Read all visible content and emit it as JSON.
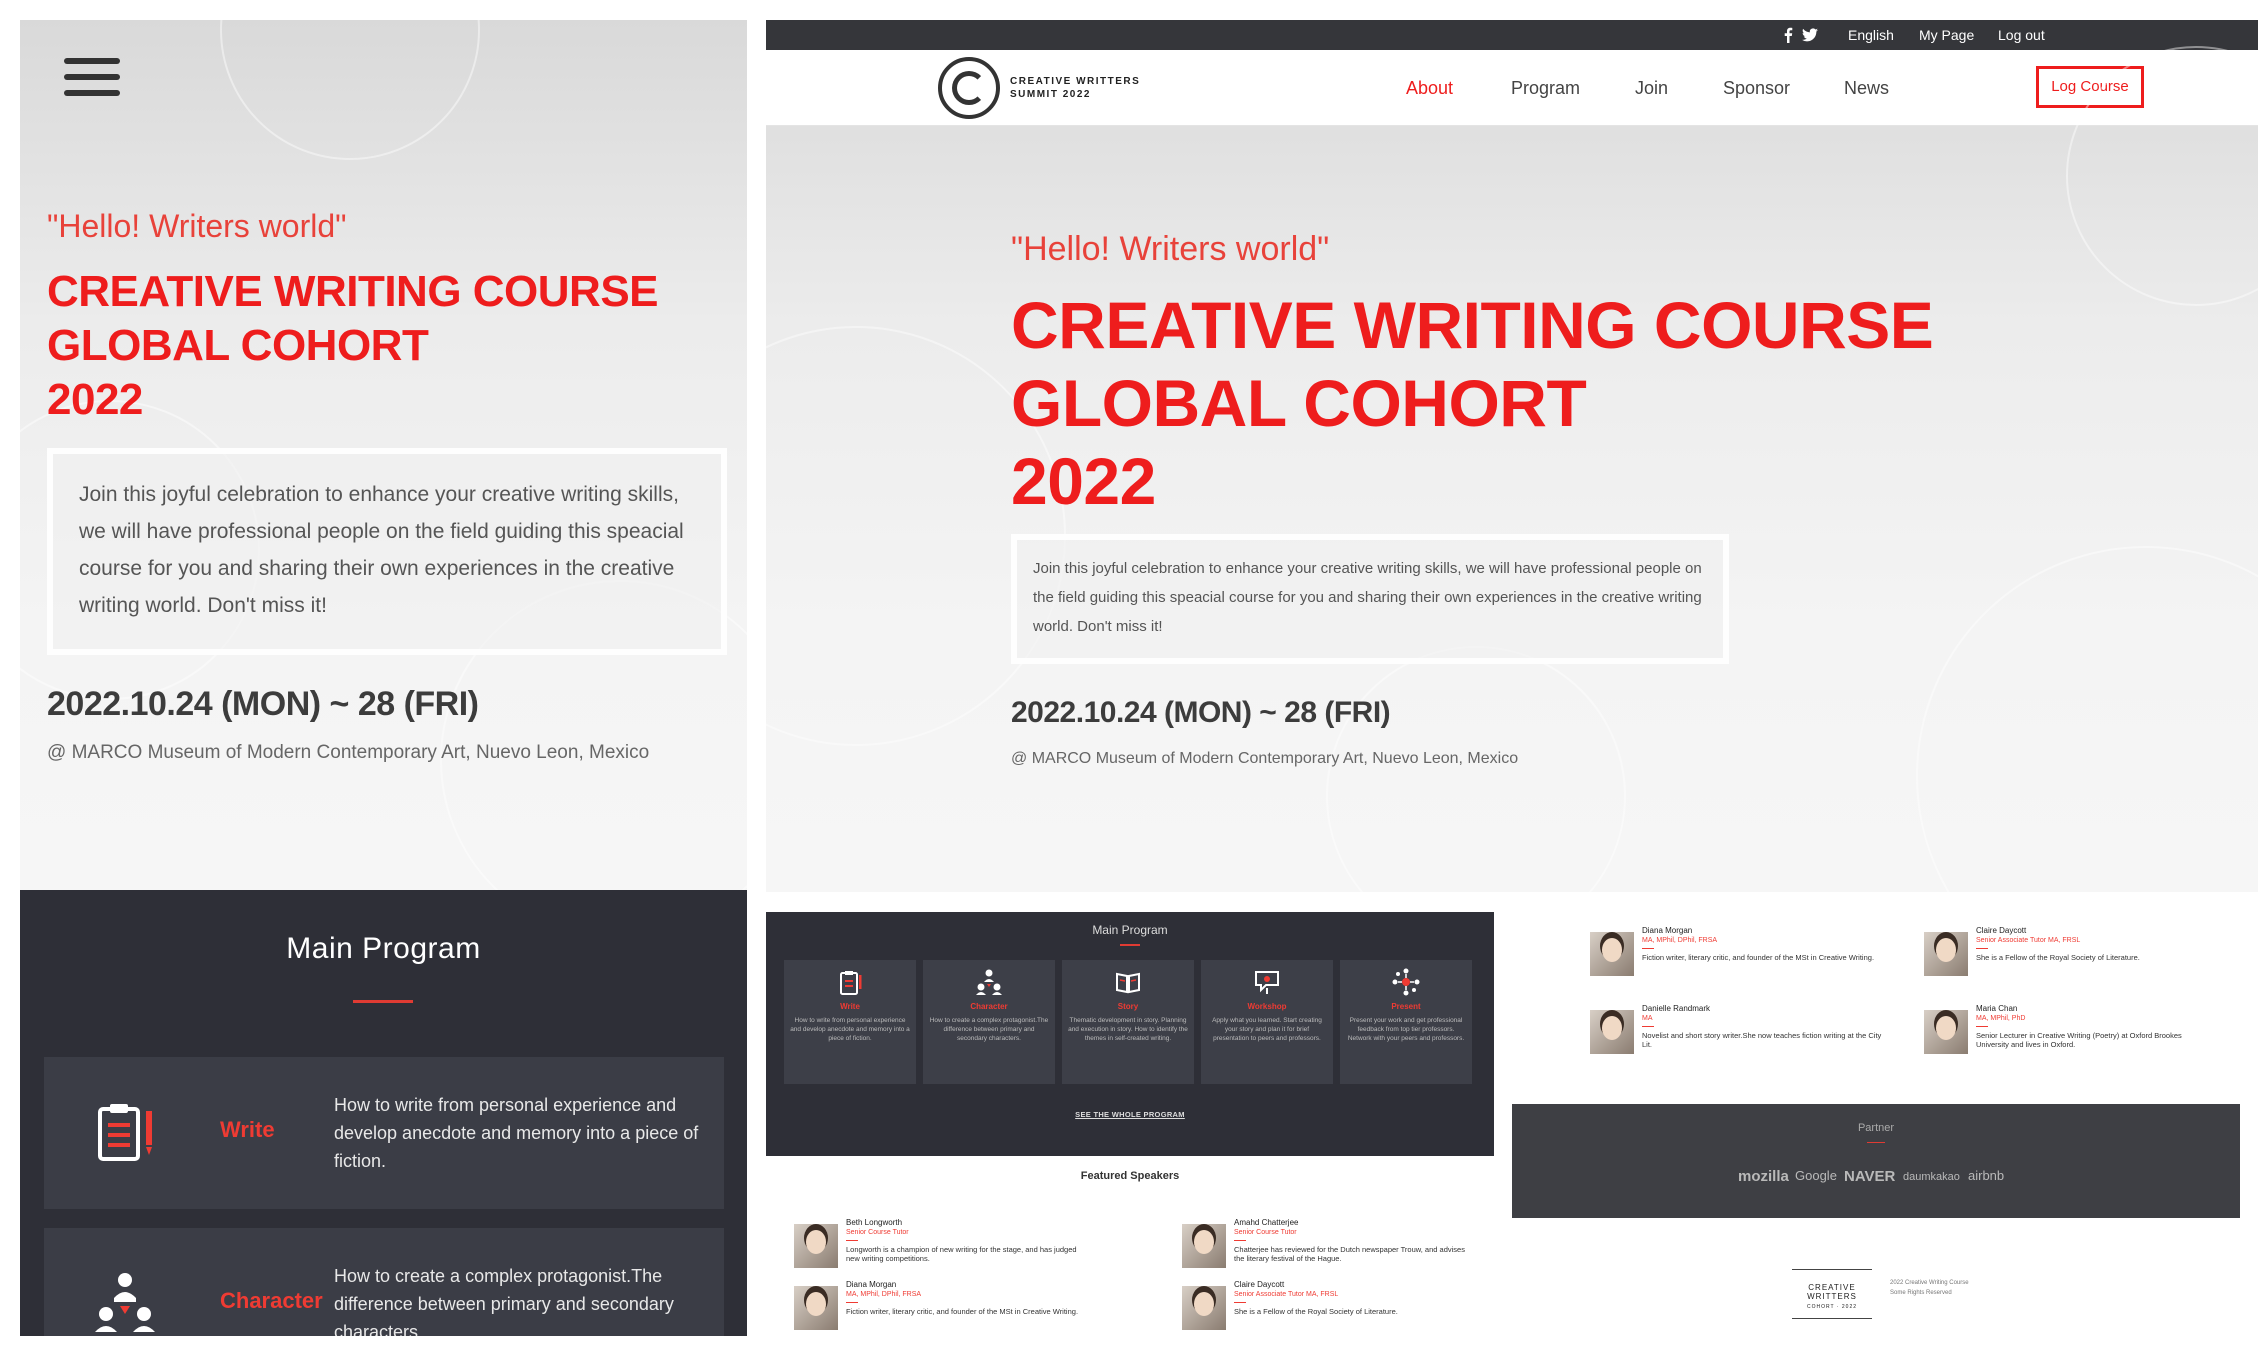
{
  "hero": {
    "greeting": "\"Hello! Writers world\"",
    "title_line1": "CREATIVE WRITING COURSE",
    "title_line2": "GLOBAL COHORT",
    "title_line3": "2022",
    "intro": "Join this joyful celebration to enhance your creative writing skills, we will have professional people on the field guiding this speacial course for you and sharing their own experiences in the creative writing world. Don't miss it!",
    "dates": "2022.10.24 (MON) ~ 28 (FRI)",
    "venue": "@ MARCO Museum of Modern Contemporary Art, Nuevo Leon, Mexico"
  },
  "topbar": {
    "language": "English",
    "mypage": "My Page",
    "logout": "Log out"
  },
  "brand": {
    "line1": "CREATIVE WRITTERS",
    "line2": "SUMMIT 2022"
  },
  "nav": {
    "about": "About",
    "program": "Program",
    "join": "Join",
    "sponsor": "Sponsor",
    "news": "News",
    "cta": "Log Course"
  },
  "program": {
    "title": "Main Program",
    "see_all": "SEE THE WHOLE PROGRAM",
    "items": [
      {
        "label": "Write",
        "desc": "How to write from personal experience and develop anecdote and memory into a piece of fiction."
      },
      {
        "label": "Character",
        "desc": "How to create a complex protagonist.The difference between primary and secondary characters."
      },
      {
        "label": "Story",
        "desc": "Thematic development in story. Planning and execution in story. How to identify the themes in self-created writing."
      },
      {
        "label": "Workshop",
        "desc": "Apply what you learned. Start creating your story and plan it for brief presentation to peers and professors."
      },
      {
        "label": "Present",
        "desc": "Present your work and get professional feedback from top tier professors. Network with your peers and professors."
      }
    ]
  },
  "featured": {
    "title": "Featured Speakers",
    "speakers": [
      {
        "name": "Beth Longworth",
        "role": "Senior Course Tutor",
        "bio": "Longworth is a champion of new writing for the stage, and has judged new writing competitions."
      },
      {
        "name": "Amahd Chatterjee",
        "role": "Senior Course Tutor",
        "bio": "Chatterjee has reviewed for the Dutch newspaper Trouw, and advises the literary festival of the Hague."
      },
      {
        "name": "Diana Morgan",
        "role": "MA, MPhil, DPhil, FRSA",
        "bio": "Fiction writer, literary critic, and founder of the MSt in Creative Writing."
      },
      {
        "name": "Claire Daycott",
        "role": "Senior Associate Tutor MA, FRSL",
        "bio": "She is a Fellow of the Royal Society of Literature."
      },
      {
        "name": "Danielle Randmark",
        "role": "MA",
        "bio": "Novelist and short story writer.She now teaches fiction writing at the City Lit."
      },
      {
        "name": "Maria Chan",
        "role": "MA, MPhil, PhD",
        "bio": "Senior Lecturer in Creative Writing (Poetry) at Oxford Brookes University and lives in Oxford."
      }
    ]
  },
  "partner": {
    "title": "Partner",
    "logos": [
      "mozilla",
      "Google",
      "NAVER",
      "daumkakao",
      "airbnb"
    ]
  },
  "footer": {
    "logo_line1": "CREATIVE WRITTERS",
    "logo_line2": "COHORT · 2022",
    "meta_line1": "2022 Creative Writing Course",
    "meta_line2": "Some Rights Reserved"
  },
  "colors": {
    "accent": "#ee1d1d",
    "dark_panel": "#2e2f37",
    "card": "#3b3d46"
  }
}
